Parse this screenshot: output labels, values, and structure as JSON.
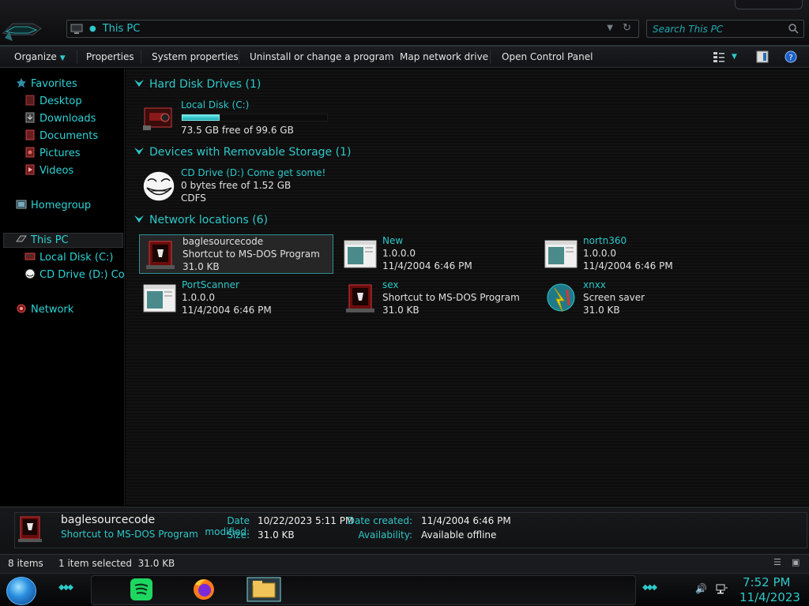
{
  "window": {
    "address_path": "This PC",
    "search_placeholder": "Search This PC"
  },
  "commands": {
    "organize": "Organize",
    "properties": "Properties",
    "system_properties": "System properties",
    "uninstall": "Uninstall or change a program",
    "map_drive": "Map network drive",
    "control_panel": "Open Control Panel"
  },
  "nav": {
    "favorites": "Favorites",
    "desktop": "Desktop",
    "downloads": "Downloads",
    "documents": "Documents",
    "pictures": "Pictures",
    "videos": "Videos",
    "homegroup": "Homegroup",
    "this_pc": "This PC",
    "local_disk": "Local Disk (C:)",
    "cd_drive": "CD Drive (D:) Com",
    "network": "Network"
  },
  "groups": {
    "hdd": "Hard Disk Drives (1)",
    "removable": "Devices with Removable Storage (1)",
    "network": "Network locations (6)"
  },
  "drives": {
    "c": {
      "name": "Local Disk (C:)",
      "free": "73.5 GB free of 99.6 GB",
      "used_fraction": 0.26
    },
    "d": {
      "name": "CD Drive (D:) Come get some!",
      "free": "0 bytes free of 1.52 GB",
      "fs": "CDFS"
    }
  },
  "network_items": [
    {
      "name": "baglesourcecode",
      "line2": "Shortcut to MS-DOS Program",
      "line3": "31.0 KB"
    },
    {
      "name": "New",
      "line2": "1.0.0.0",
      "line3": "11/4/2004 6:46 PM"
    },
    {
      "name": "nortn360",
      "line2": "1.0.0.0",
      "line3": "11/4/2004 6:46 PM"
    },
    {
      "name": "PortScanner",
      "line2": "1.0.0.0",
      "line3": "11/4/2004 6:46 PM"
    },
    {
      "name": "sex",
      "line2": "Shortcut to MS-DOS Program",
      "line3": "31.0 KB"
    },
    {
      "name": "xnxx",
      "line2": "Screen saver",
      "line3": "31.0 KB"
    }
  ],
  "details": {
    "name": "baglesourcecode",
    "type": "Shortcut to MS-DOS Program",
    "date_modified_label": "Date modified:",
    "date_modified": "10/22/2023 5:11 PM",
    "size_label": "Size:",
    "size": "31.0 KB",
    "date_created_label": "Date created:",
    "date_created": "11/4/2004 6:46 PM",
    "availability_label": "Availability:",
    "availability": "Available offline"
  },
  "status": {
    "items": "8 items",
    "selected": "1 item selected  31.0 KB"
  },
  "clock": {
    "time": "7:52 PM",
    "date": "11/4/2023"
  },
  "colors": {
    "accent": "#2ec8c8",
    "text": "#e0e0e0",
    "background": "#000000"
  },
  "icons": {
    "organize": "chevron-down-icon",
    "help": "help-icon",
    "views": "view-options-icon",
    "preview_pane": "preview-pane-icon"
  }
}
